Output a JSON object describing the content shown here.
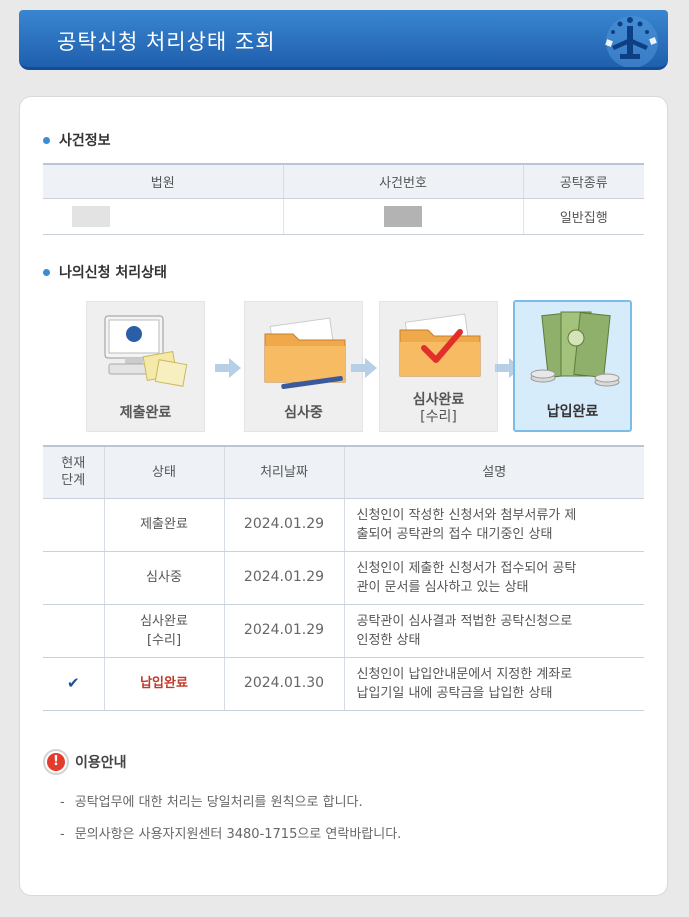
{
  "header": {
    "title": "공탁신청 처리상태 조회"
  },
  "case_info": {
    "section_title": "사건정보",
    "columns": [
      "법원",
      "사건번호",
      "공탁종류"
    ],
    "row": {
      "court": "",
      "case_number": "",
      "deposit_type": "일반집행"
    }
  },
  "status": {
    "section_title": "나의신청 처리상태",
    "steps": [
      {
        "label": "제출완료",
        "label2": "",
        "icon": "computer-documents-icon",
        "active": false
      },
      {
        "label": "심사중",
        "label2": "",
        "icon": "folder-pen-icon",
        "active": false
      },
      {
        "label": "심사완료",
        "label2": "[수리]",
        "icon": "folder-check-icon",
        "active": false
      },
      {
        "label": "납입완료",
        "label2": "",
        "icon": "money-icon",
        "active": true
      }
    ],
    "columns": {
      "current_step_line1": "현재",
      "current_step_line2": "단계",
      "state": "상태",
      "date": "처리날짜",
      "description": "설명"
    },
    "rows": [
      {
        "current": false,
        "state": "제출완료",
        "state2": "",
        "date": "2024.01.29",
        "desc1": "신청인이 작성한 신청서와 첨부서류가 제",
        "desc2": "출되어 공탁관의 접수 대기중인 상태"
      },
      {
        "current": false,
        "state": "심사중",
        "state2": "",
        "date": "2024.01.29",
        "desc1": "신청인이 제출한 신청서가 접수되어 공탁",
        "desc2": "관이 문서를 심사하고 있는 상태"
      },
      {
        "current": false,
        "state": "심사완료",
        "state2": "[수리]",
        "date": "2024.01.29",
        "desc1": "공탁관이 심사결과 적법한 공탁신청으로",
        "desc2": "인정한 상태"
      },
      {
        "current": true,
        "state": "납입완료",
        "state2": "",
        "date": "2024.01.30",
        "desc1": "신청인이 납입안내문에서 지정한 계좌로",
        "desc2": "납입기일 내에 공탁금을 납입한 상태"
      }
    ],
    "check_mark": "✔"
  },
  "notice": {
    "title": "이용안내",
    "icon_text": "!",
    "items": [
      "공탁업무에 대한 처리는 당일처리를 원칙으로 합니다.",
      "문의사항은 사용자지원센터 3480-1715으로 연락바랍니다."
    ],
    "dash": "-"
  },
  "colors": {
    "accent": "#2a72c3",
    "current_state": "#c0392b",
    "active_step_bg": "#d7ecfa"
  }
}
